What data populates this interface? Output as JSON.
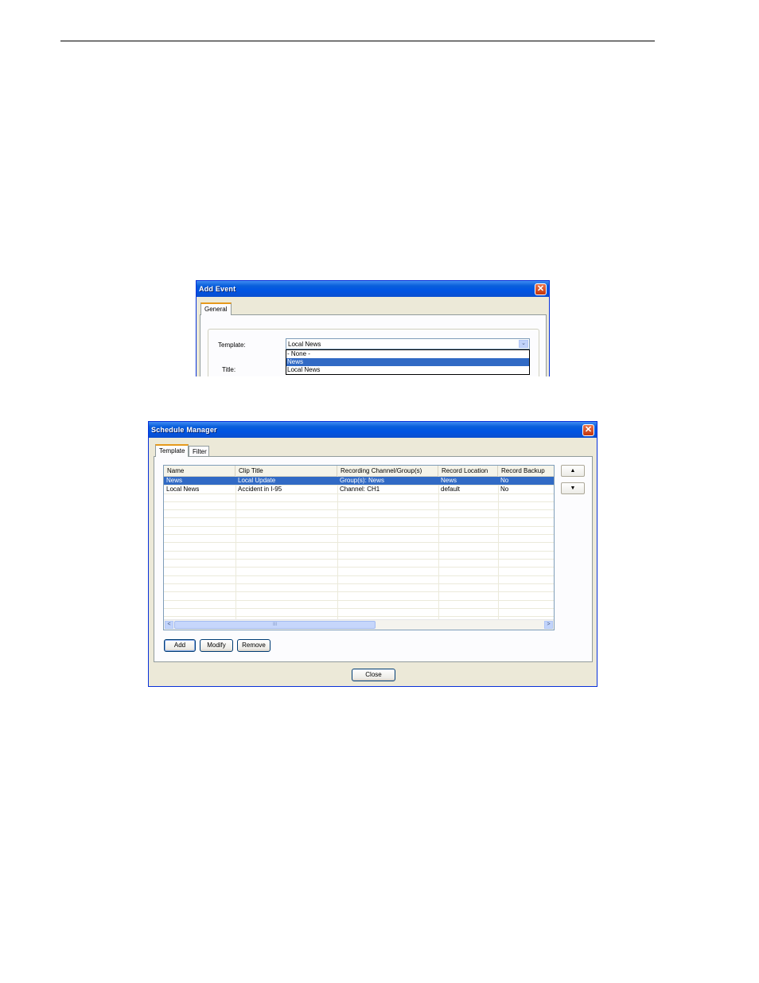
{
  "add_event": {
    "title": "Add Event",
    "close_glyph": "✕",
    "tabs": [
      {
        "label": "General"
      }
    ],
    "template_label": "Template:",
    "template_value": "Local News",
    "dropdown_arrow": "⌄",
    "dropdown_options": [
      "- None -",
      "News",
      "Local News"
    ],
    "title_label": "Title:"
  },
  "schedule_manager": {
    "title": "Schedule Manager",
    "close_glyph": "✕",
    "tabs": [
      {
        "label": "Template"
      },
      {
        "label": "Filter"
      }
    ],
    "columns": [
      "Name",
      "Clip Title",
      "Recording Channel/Group(s)",
      "Record Location",
      "Record Backup"
    ],
    "rows": [
      [
        "News",
        "Local Update",
        "Group(s): News",
        "News",
        "No"
      ],
      [
        "Local News",
        "Accident in I-95",
        "Channel: CH1",
        "default",
        "No"
      ]
    ],
    "selected_row": 0,
    "scroll_left": "<",
    "scroll_right": ">",
    "scroll_grip": "III",
    "move_up": "▲",
    "move_down": "▼",
    "buttons": {
      "add": "Add",
      "modify": "Modify",
      "remove": "Remove",
      "close": "Close"
    }
  },
  "colors": {
    "title_bar": "#0054e3",
    "selection": "#316ac5",
    "window_bg": "#ece9d8"
  }
}
